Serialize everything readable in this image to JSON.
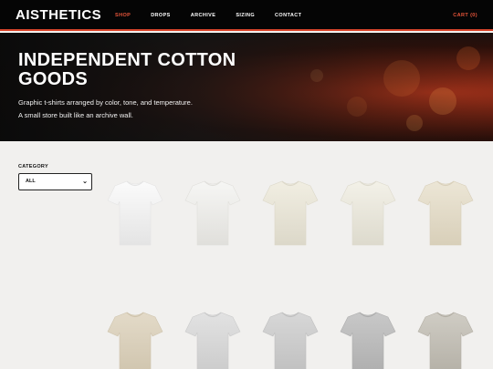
{
  "header": {
    "logo": "AISTHETICS",
    "nav": [
      {
        "label": "SHOP",
        "active": true
      },
      {
        "label": "DROPS",
        "active": false
      },
      {
        "label": "ARCHIVE",
        "active": false
      },
      {
        "label": "SIZING",
        "active": false
      },
      {
        "label": "CONTACT",
        "active": false
      }
    ],
    "cart": "CART (0)"
  },
  "hero": {
    "title": "INDEPENDENT COTTON GOODS",
    "line1": "Graphic t-shirts arranged by color, tone, and temperature.",
    "line2": "A small store built like an archive wall."
  },
  "filter": {
    "label": "CATEGORY",
    "selected": "ALL"
  },
  "products": [
    {
      "color": "#fbfbfb",
      "shade": "#e4e4e4"
    },
    {
      "color": "#f6f6f4",
      "shade": "#e0dfdb"
    },
    {
      "color": "#f1eee2",
      "shade": "#dcd8c9"
    },
    {
      "color": "#f3f1e8",
      "shade": "#dddacd"
    },
    {
      "color": "#ece6d6",
      "shade": "#d8cfb9"
    },
    {
      "color": "#e3dac8",
      "shade": "#cfc4ad"
    },
    {
      "color": "#e2e2e2",
      "shade": "#cacaca"
    },
    {
      "color": "#d7d7d7",
      "shade": "#bfbfbf"
    },
    {
      "color": "#c8c8c8",
      "shade": "#adadad"
    },
    {
      "color": "#cfccc4",
      "shade": "#b3afa5"
    }
  ],
  "colors": {
    "accent": "#e8553a",
    "header_bg": "#050505",
    "page_bg": "#f1f0ee"
  }
}
